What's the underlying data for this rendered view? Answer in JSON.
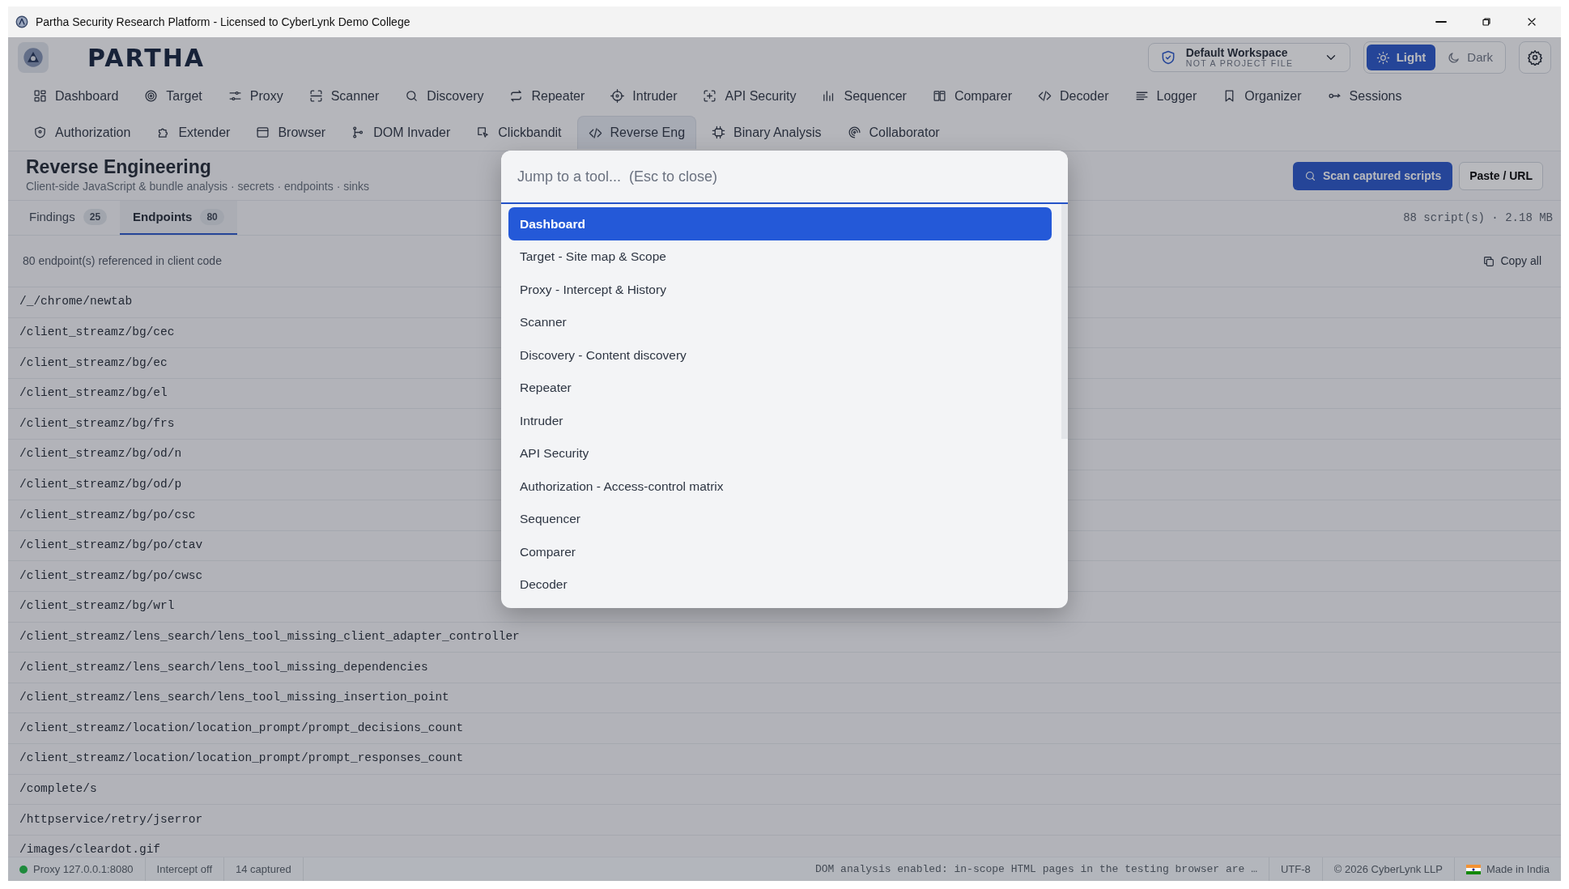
{
  "window": {
    "title": "Partha Security Research Platform - Licensed to CyberLynk Demo College"
  },
  "brand": {
    "name": "PARTHA"
  },
  "workspace": {
    "name": "Default Workspace",
    "subtitle": "NOT A PROJECT FILE"
  },
  "theme_toggle": [
    {
      "label": "Light",
      "selected": true
    },
    {
      "label": "Dark",
      "selected": false
    }
  ],
  "nav_rows": [
    [
      {
        "label": "Dashboard",
        "selected": false
      },
      {
        "label": "Target",
        "selected": false
      },
      {
        "label": "Proxy",
        "selected": false
      },
      {
        "label": "Scanner",
        "selected": false
      },
      {
        "label": "Discovery",
        "selected": false
      },
      {
        "label": "Repeater",
        "selected": false
      },
      {
        "label": "Intruder",
        "selected": false
      },
      {
        "label": "API Security",
        "selected": false
      },
      {
        "label": "Sequencer",
        "selected": false
      },
      {
        "label": "Comparer",
        "selected": false
      },
      {
        "label": "Decoder",
        "selected": false
      },
      {
        "label": "Logger",
        "selected": false
      },
      {
        "label": "Organizer",
        "selected": false
      },
      {
        "label": "Sessions",
        "selected": false
      }
    ],
    [
      {
        "label": "Authorization",
        "selected": false
      },
      {
        "label": "Extender",
        "selected": false
      },
      {
        "label": "Browser",
        "selected": false
      },
      {
        "label": "DOM Invader",
        "selected": false
      },
      {
        "label": "Clickbandit",
        "selected": false
      },
      {
        "label": "Reverse Eng",
        "selected": true
      },
      {
        "label": "Binary Analysis",
        "selected": false
      },
      {
        "label": "Collaborator",
        "selected": false
      }
    ]
  ],
  "page": {
    "title": "Reverse Engineering",
    "subtitle": "Client-side JavaScript & bundle analysis · secrets · endpoints · sinks",
    "buttons": [
      {
        "label": "Scan captured scripts",
        "kind": "primary"
      },
      {
        "label": "Paste / URL",
        "kind": "secondary"
      }
    ]
  },
  "tabs": [
    {
      "label": "Findings",
      "count": "25",
      "selected": false
    },
    {
      "label": "Endpoints",
      "count": "80",
      "selected": true
    }
  ],
  "script_summary": "88 script(s) · 2.18 MB",
  "endpoints": {
    "summary": "80 endpoint(s) referenced in client code",
    "copy_button": "Copy all",
    "rows": [
      "/_/chrome/newtab",
      "/client_streamz/bg/cec",
      "/client_streamz/bg/ec",
      "/client_streamz/bg/el",
      "/client_streamz/bg/frs",
      "/client_streamz/bg/od/n",
      "/client_streamz/bg/od/p",
      "/client_streamz/bg/po/csc",
      "/client_streamz/bg/po/ctav",
      "/client_streamz/bg/po/cwsc",
      "/client_streamz/bg/wrl",
      "/client_streamz/lens_search/lens_tool_missing_client_adapter_controller",
      "/client_streamz/lens_search/lens_tool_missing_dependencies",
      "/client_streamz/lens_search/lens_tool_missing_insertion_point",
      "/client_streamz/location/location_prompt/prompt_decisions_count",
      "/client_streamz/location/location_prompt/prompt_responses_count",
      "/complete/s",
      "/httpservice/retry/jserror",
      "/images/cleardot.gif"
    ]
  },
  "command_palette": {
    "placeholder": "Jump to a tool...  (Esc to close)",
    "items": [
      {
        "label": "Dashboard",
        "selected": true
      },
      {
        "label": "Target - Site map & Scope",
        "selected": false
      },
      {
        "label": "Proxy - Intercept & History",
        "selected": false
      },
      {
        "label": "Scanner",
        "selected": false
      },
      {
        "label": "Discovery - Content discovery",
        "selected": false
      },
      {
        "label": "Repeater",
        "selected": false
      },
      {
        "label": "Intruder",
        "selected": false
      },
      {
        "label": "API Security",
        "selected": false
      },
      {
        "label": "Authorization - Access-control matrix",
        "selected": false
      },
      {
        "label": "Sequencer",
        "selected": false
      },
      {
        "label": "Comparer",
        "selected": false
      },
      {
        "label": "Decoder",
        "selected": false
      }
    ]
  },
  "status_bar": {
    "proxy": {
      "label": "Proxy 127.0.0.1:8080",
      "color": "#1e8a3c"
    },
    "intercept": "Intercept off",
    "captured": "14 captured",
    "message": "DOM analysis enabled: in-scope HTML pages in the testing browser are …",
    "encoding": "UTF-8",
    "copyright": "© 2026 CyberLynk LLP",
    "made_in": "Made in India"
  }
}
